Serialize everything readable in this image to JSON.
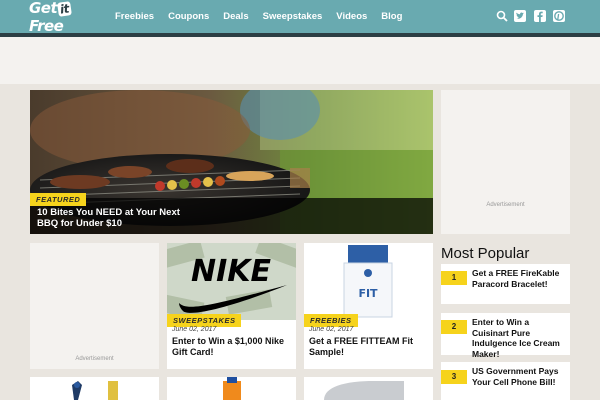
{
  "header": {
    "logo": {
      "part1": "Get",
      "part2": "it",
      "part3": "Free"
    },
    "nav": [
      "Freebies",
      "Coupons",
      "Deals",
      "Sweepstakes",
      "Videos",
      "Blog"
    ],
    "icons": [
      "search-icon",
      "twitter-icon",
      "facebook-icon",
      "pinterest-icon"
    ]
  },
  "hero": {
    "tag": "FEATURED",
    "title": "10 Bites You NEED at Your Next BBQ for Under $10"
  },
  "ads": {
    "label": "Advertisement"
  },
  "cards": [
    {
      "tag": "SWEEPSTAKES",
      "date": "June 02, 2017",
      "title": "Enter to Win a $1,000 Nike Gift Card!",
      "brand": "NIKE"
    },
    {
      "tag": "FREEBIES",
      "date": "June 02, 2017",
      "title": "Get a FREE FITTEAM Fit Sample!",
      "brand": "FIT"
    }
  ],
  "popular": {
    "title": "Most Popular",
    "items": [
      {
        "num": "1",
        "text": "Get a FREE FireKable Paracord Bracelet!"
      },
      {
        "num": "2",
        "text": "Enter to Win a Cuisinart Pure Indulgence Ice Cream Maker!"
      },
      {
        "num": "3",
        "text": "US Government Pays Your Cell Phone Bill!"
      }
    ]
  },
  "colors": {
    "header": "#69aab0",
    "accent": "#f6d31c",
    "background": "#e9e5df"
  }
}
